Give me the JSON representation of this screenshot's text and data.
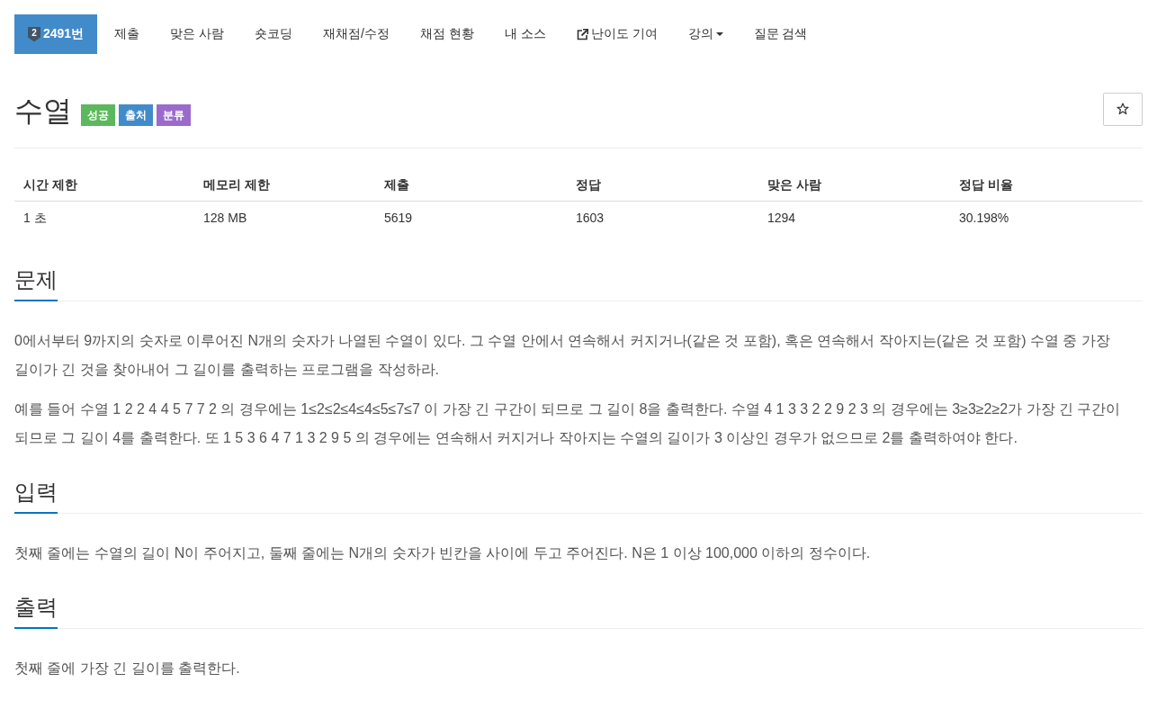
{
  "tabs": [
    {
      "kind": "problem",
      "tier": "2",
      "label": "2491번",
      "selected": true
    },
    {
      "kind": "plain",
      "label": "제출",
      "selected": false
    },
    {
      "kind": "plain",
      "label": "맞은 사람",
      "selected": false
    },
    {
      "kind": "plain",
      "label": "숏코딩",
      "selected": false
    },
    {
      "kind": "plain",
      "label": "재채점/수정",
      "selected": false
    },
    {
      "kind": "plain",
      "label": "채점 현황",
      "selected": false
    },
    {
      "kind": "plain",
      "label": "내 소스",
      "selected": false
    },
    {
      "kind": "external",
      "label": "난이도 기여",
      "selected": false
    },
    {
      "kind": "menu",
      "label": "강의",
      "selected": false
    },
    {
      "kind": "plain",
      "label": "질문 검색",
      "selected": false
    }
  ],
  "problem": {
    "title": "수열",
    "labels": [
      {
        "text": "성공",
        "color": "#5cb85c"
      },
      {
        "text": "출처",
        "color": "#428bca"
      },
      {
        "text": "분류",
        "color": "#9b6bcc"
      }
    ]
  },
  "info_table": {
    "columns": [
      "시간 제한",
      "메모리 제한",
      "제출",
      "정답",
      "맞은 사람",
      "정답 비율"
    ],
    "rows": [
      [
        "1 초",
        "128 MB",
        "5619",
        "1603",
        "1294",
        "30.198%"
      ]
    ]
  },
  "sections": [
    {
      "heading": "문제",
      "paragraphs": [
        "0에서부터 9까지의 숫자로 이루어진 N개의 숫자가 나열된 수열이 있다. 그 수열 안에서 연속해서 커지거나(같은 것 포함), 혹은 연속해서 작아지는(같은 것 포함) 수열 중 가장 길이가 긴 것을 찾아내어 그 길이를 출력하는 프로그램을 작성하라.",
        "예를 들어 수열 1 2 2 4 4 5 7 7 2 의 경우에는 1≤2≤2≤4≤4≤5≤7≤7 이 가장 긴 구간이 되므로 그 길이 8을 출력한다. 수열 4 1 3 3 2 2 9 2 3 의 경우에는 3≥3≥2≥2가 가장 긴 구간이 되므로 그 길이 4를 출력한다. 또 1 5 3 6 4 7 1 3 2 9 5 의 경우에는 연속해서 커지거나 작아지는 수열의 길이가 3 이상인 경우가 없으므로 2를 출력하여야 한다."
      ]
    },
    {
      "heading": "입력",
      "paragraphs": [
        "첫째 줄에는 수열의 길이 N이 주어지고, 둘째 줄에는 N개의 숫자가 빈칸을 사이에 두고 주어진다. N은 1 이상 100,000 이하의 정수이다."
      ]
    },
    {
      "heading": "출력",
      "paragraphs": [
        "첫째 줄에 가장 긴 길이를 출력한다."
      ]
    }
  ]
}
